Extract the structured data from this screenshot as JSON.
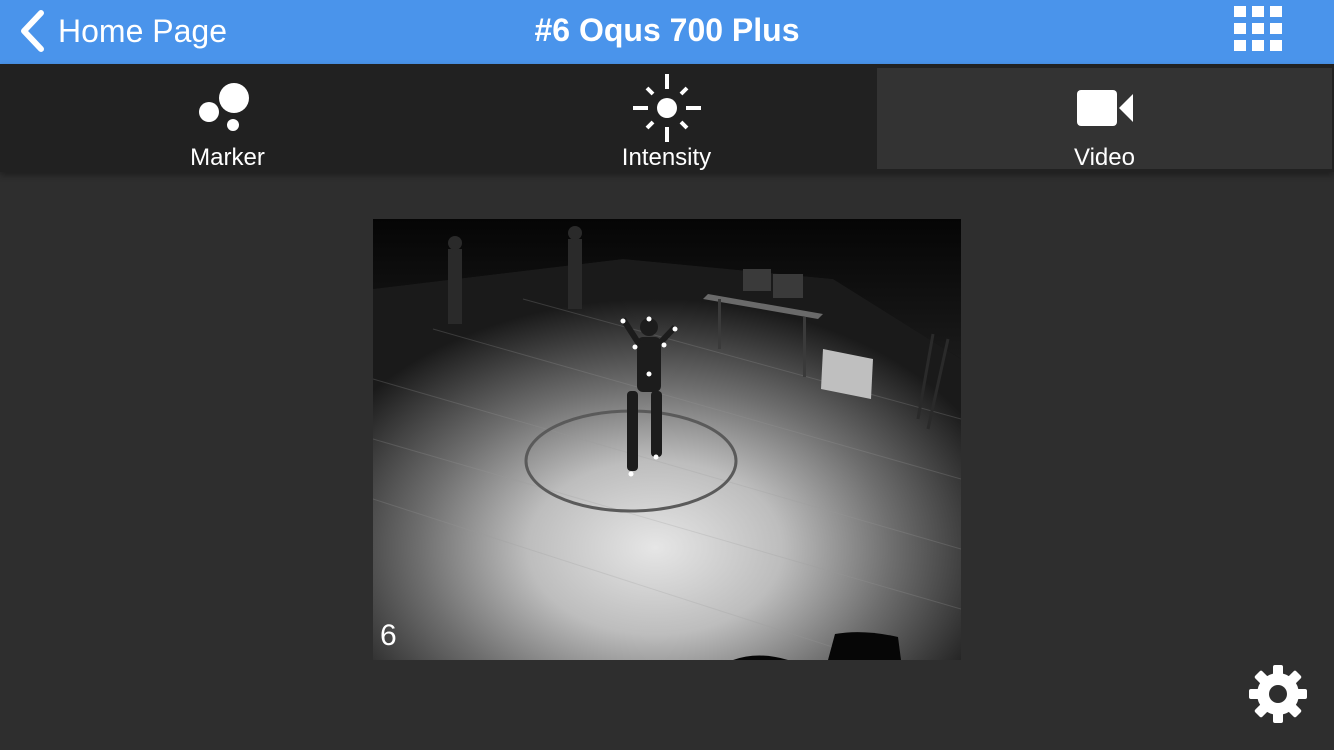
{
  "nav": {
    "back_label": "Home Page",
    "title": "#6 Oqus 700 Plus",
    "back_icon": "chevron-left-icon",
    "grid_icon": "grid-icon"
  },
  "tabs": [
    {
      "label": "Marker",
      "icon": "marker-dots-icon",
      "active": false
    },
    {
      "label": "Intensity",
      "icon": "intensity-sun-icon",
      "active": false
    },
    {
      "label": "Video",
      "icon": "video-camera-icon",
      "active": true
    }
  ],
  "video": {
    "camera_number": "6"
  },
  "settings": {
    "icon": "gear-icon"
  },
  "colors": {
    "nav_blue": "#4a94eb",
    "background": "#2e2e2e",
    "tab_bar": "#212121",
    "tab_active": "#333333"
  }
}
